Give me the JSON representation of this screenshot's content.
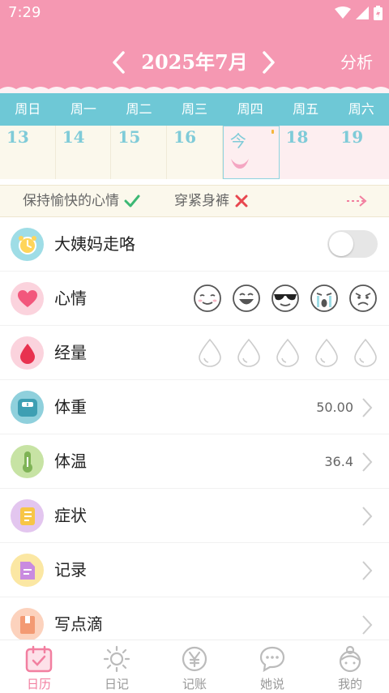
{
  "status_bar": {
    "time": "7:29"
  },
  "header": {
    "month_title": "2025年7月",
    "analyze_label": "分析",
    "colors": {
      "header_pink": "#f598b2",
      "weekbar_teal": "#6ec8d6"
    }
  },
  "calendar": {
    "weekdays": [
      "周日",
      "周一",
      "周二",
      "周三",
      "周四",
      "周五",
      "周六"
    ],
    "days": [
      "13",
      "14",
      "15",
      "16",
      "今",
      "18",
      "19"
    ]
  },
  "tips": {
    "do_label": "保持愉快的心情",
    "dont_label": "穿紧身裤"
  },
  "records": {
    "period": {
      "label": "大姨妈走咯",
      "toggle_on": false
    },
    "mood": {
      "label": "心情",
      "options": [
        "smile-closed-eyes",
        "grin",
        "cool-sunglasses",
        "crying",
        "angry"
      ]
    },
    "flow": {
      "label": "经量",
      "levels": 5
    },
    "weight": {
      "label": "体重",
      "value": "50.00"
    },
    "temperature": {
      "label": "体温",
      "value": "36.4"
    },
    "symptoms": {
      "label": "症状"
    },
    "notes": {
      "label": "记录"
    },
    "write": {
      "label": "写点滴"
    }
  },
  "tabs": [
    {
      "label": "日历",
      "icon": "calendar-icon",
      "active": true
    },
    {
      "label": "日记",
      "icon": "sun-icon",
      "active": false
    },
    {
      "label": "记账",
      "icon": "yen-icon",
      "active": false
    },
    {
      "label": "她说",
      "icon": "chat-icon",
      "active": false
    },
    {
      "label": "我的",
      "icon": "girl-avatar-icon",
      "active": false
    }
  ]
}
